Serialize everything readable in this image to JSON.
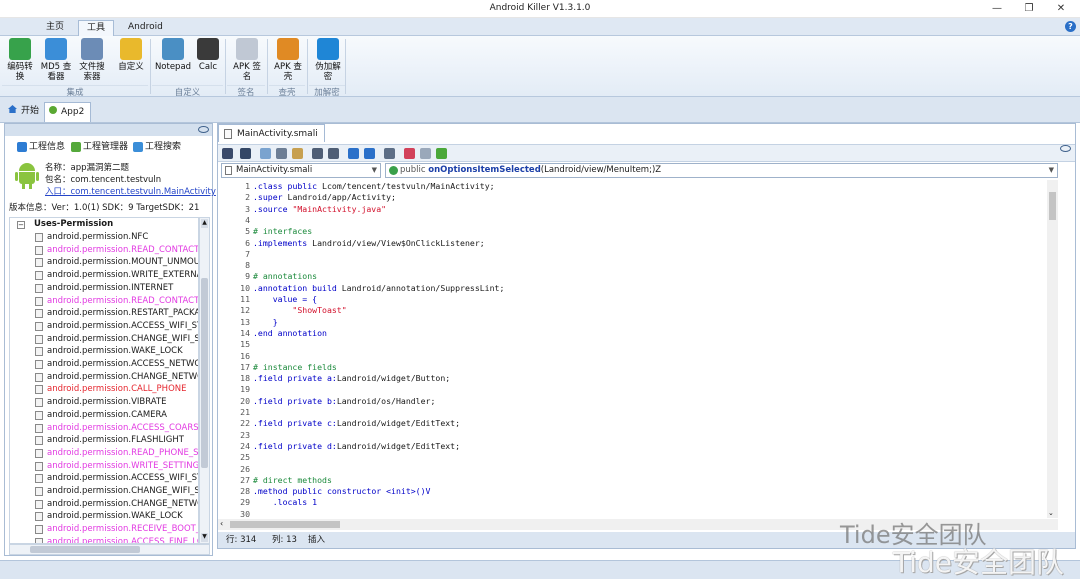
{
  "window": {
    "title": "Android Killer V1.3.1.0",
    "minimize": "—",
    "maximize": "❐",
    "close": "✕"
  },
  "ribbon_tabs": [
    "主页",
    "工具",
    "Android"
  ],
  "ribbon_buttons": [
    {
      "label": "编码转\n换",
      "icon": "convert-icon",
      "color": "#37a24b"
    },
    {
      "label": "MD5 查\n看器",
      "icon": "md5-icon",
      "color": "#3b8ed8"
    },
    {
      "label": "文件搜\n索器",
      "icon": "file-search-icon",
      "color": "#6c8cb6"
    },
    {
      "label": "自定义",
      "icon": "star-icon",
      "color": "#e9b92c"
    },
    {
      "label": "Notepad",
      "icon": "notepad-icon",
      "color": "#4a8fc4"
    },
    {
      "label": "Calc",
      "icon": "calculator-icon",
      "color": "#3a3a3a"
    },
    {
      "label": "APK 签\n名",
      "icon": "sign-icon",
      "color": "#c0c8d4"
    },
    {
      "label": "APK 查\n壳",
      "icon": "shell-icon",
      "color": "#e08a24"
    },
    {
      "label": "伪加解\n密",
      "icon": "lock-icon",
      "color": "#1f86d6"
    }
  ],
  "ribbon_groups": [
    "集成",
    "自定义",
    "签名",
    "查壳",
    "加解密"
  ],
  "doc_tabs": [
    "开始",
    "App2"
  ],
  "left_tabs": [
    "工程信息",
    "工程管理器",
    "工程搜索"
  ],
  "app_info": {
    "name": "名称：app漏洞第二题",
    "package": "包名：com.tencent.testvuln",
    "entry": "入口：com.tencent.testvuln.MainActivity",
    "version": "版本信息：Ver：1.0(1) SDK：9 TargetSDK：21"
  },
  "permissions_title": "Uses-Permission",
  "permissions": [
    {
      "text": "android.permission.NFC",
      "color": "#1a1a1a"
    },
    {
      "text": "android.permission.READ_CONTACTS",
      "color": "#e23ae2"
    },
    {
      "text": "android.permission.MOUNT_UNMOUNT_FILESYSTEMS",
      "color": "#1a1a1a"
    },
    {
      "text": "android.permission.WRITE_EXTERNAL_STORAGE",
      "color": "#1a1a1a"
    },
    {
      "text": "android.permission.INTERNET",
      "color": "#1a1a1a"
    },
    {
      "text": "android.permission.READ_CONTACTS",
      "color": "#e23ae2"
    },
    {
      "text": "android.permission.RESTART_PACKAGES",
      "color": "#1a1a1a"
    },
    {
      "text": "android.permission.ACCESS_WIFI_STATE",
      "color": "#1a1a1a"
    },
    {
      "text": "android.permission.CHANGE_WIFI_STATE",
      "color": "#1a1a1a"
    },
    {
      "text": "android.permission.WAKE_LOCK",
      "color": "#1a1a1a"
    },
    {
      "text": "android.permission.ACCESS_NETWORK_STATE",
      "color": "#1a1a1a"
    },
    {
      "text": "android.permission.CHANGE_NETWORK_STATE",
      "color": "#1a1a1a"
    },
    {
      "text": "android.permission.CALL_PHONE",
      "color": "#e5262e"
    },
    {
      "text": "android.permission.VIBRATE",
      "color": "#1a1a1a"
    },
    {
      "text": "android.permission.CAMERA",
      "color": "#1a1a1a"
    },
    {
      "text": "android.permission.ACCESS_COARSE_LOCATION",
      "color": "#e23ae2"
    },
    {
      "text": "android.permission.FLASHLIGHT",
      "color": "#1a1a1a"
    },
    {
      "text": "android.permission.READ_PHONE_STATE",
      "color": "#e23ae2"
    },
    {
      "text": "android.permission.WRITE_SETTINGS",
      "color": "#e23ae2"
    },
    {
      "text": "android.permission.ACCESS_WIFI_STATE",
      "color": "#1a1a1a"
    },
    {
      "text": "android.permission.CHANGE_WIFI_STATE",
      "color": "#1a1a1a"
    },
    {
      "text": "android.permission.CHANGE_NETWORK_STATE",
      "color": "#1a1a1a"
    },
    {
      "text": "android.permission.WAKE_LOCK",
      "color": "#1a1a1a"
    },
    {
      "text": "android.permission.RECEIVE_BOOT_COMPLETED",
      "color": "#e23ae2"
    },
    {
      "text": "android.permission.ACCESS_FINE_LOCATION",
      "color": "#e23ae2"
    }
  ],
  "editor": {
    "file_tab": "MainActivity.smali",
    "combo_file": "MainActivity.smali",
    "combo_method_prefix": "public",
    "combo_method_name": "onOptionsItemSelected",
    "combo_method_sig": "(Landroid/view/MenuItem;)Z",
    "lines": [
      [
        {
          "t": ".class ",
          "c": "kw"
        },
        {
          "t": "public ",
          "c": "kw"
        },
        {
          "t": "Lcom/tencent/testvuln/MainActivity;",
          "c": "ty"
        }
      ],
      [
        {
          "t": ".super ",
          "c": "kw"
        },
        {
          "t": "Landroid/app/Activity;",
          "c": "ty"
        }
      ],
      [
        {
          "t": ".source ",
          "c": "kw"
        },
        {
          "t": "\"MainActivity.java\"",
          "c": "st"
        }
      ],
      [],
      [
        {
          "t": "# interfaces",
          "c": "cm"
        }
      ],
      [
        {
          "t": ".implements ",
          "c": "kw"
        },
        {
          "t": "Landroid/view/View$OnClickListener;",
          "c": "ty"
        }
      ],
      [],
      [],
      [
        {
          "t": "# annotations",
          "c": "cm"
        }
      ],
      [
        {
          "t": ".annotation ",
          "c": "kw"
        },
        {
          "t": "build ",
          "c": "kw"
        },
        {
          "t": "Landroid/annotation/SuppressLint;",
          "c": "ty"
        }
      ],
      [
        {
          "t": "    value = {",
          "c": "kw"
        }
      ],
      [
        {
          "t": "        \"ShowToast\"",
          "c": "st"
        }
      ],
      [
        {
          "t": "    }",
          "c": "kw"
        }
      ],
      [
        {
          "t": ".end annotation",
          "c": "kw"
        }
      ],
      [],
      [],
      [
        {
          "t": "# instance fields",
          "c": "cm"
        }
      ],
      [
        {
          "t": ".field ",
          "c": "kw"
        },
        {
          "t": "private ",
          "c": "kw"
        },
        {
          "t": "a:",
          "c": "kw"
        },
        {
          "t": "Landroid/widget/Button;",
          "c": "ty"
        }
      ],
      [],
      [
        {
          "t": ".field ",
          "c": "kw"
        },
        {
          "t": "private ",
          "c": "kw"
        },
        {
          "t": "b:",
          "c": "kw"
        },
        {
          "t": "Landroid/os/Handler;",
          "c": "ty"
        }
      ],
      [],
      [
        {
          "t": ".field ",
          "c": "kw"
        },
        {
          "t": "private ",
          "c": "kw"
        },
        {
          "t": "c:",
          "c": "kw"
        },
        {
          "t": "Landroid/widget/EditText;",
          "c": "ty"
        }
      ],
      [],
      [
        {
          "t": ".field ",
          "c": "kw"
        },
        {
          "t": "private ",
          "c": "kw"
        },
        {
          "t": "d:",
          "c": "kw"
        },
        {
          "t": "Landroid/widget/EditText;",
          "c": "ty"
        }
      ],
      [],
      [],
      [
        {
          "t": "# direct methods",
          "c": "cm"
        }
      ],
      [
        {
          "t": ".method ",
          "c": "kw"
        },
        {
          "t": "public ",
          "c": "kw"
        },
        {
          "t": "constructor ",
          "c": "kw"
        },
        {
          "t": "<init>()V",
          "c": "kw"
        }
      ],
      [
        {
          "t": "    .locals 1",
          "c": "kw"
        }
      ],
      []
    ]
  },
  "status": {
    "row": "行: 314",
    "col": "列: 13",
    "mode": "插入"
  },
  "watermark": "Tide安全团队",
  "watermark2": "Tide安全团队"
}
